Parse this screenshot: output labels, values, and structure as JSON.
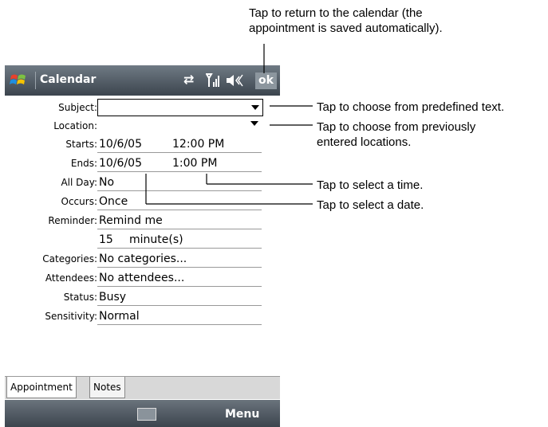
{
  "callouts": {
    "ok_note_line1": "Tap to return to the calendar (the",
    "ok_note_line2": "appointment is saved automatically).",
    "subject_note": "Tap to choose from predefined text.",
    "location_note_line1": "Tap to choose from previously",
    "location_note_line2": "entered locations.",
    "time_note": "Tap to select a time.",
    "date_note": "Tap to select a date."
  },
  "title_bar": {
    "title": "Calendar",
    "ok_label": "ok",
    "icons": [
      "windows-logo-icon",
      "connectivity-icon",
      "signal-icon",
      "volume-icon"
    ]
  },
  "form": {
    "subject": {
      "label": "Subject:",
      "value": ""
    },
    "location": {
      "label": "Location:",
      "value": ""
    },
    "starts": {
      "label": "Starts:",
      "date": "10/6/05",
      "time": "12:00 PM"
    },
    "ends": {
      "label": "Ends:",
      "date": "10/6/05",
      "time": "1:00 PM"
    },
    "all_day": {
      "label": "All Day:",
      "value": "No"
    },
    "occurs": {
      "label": "Occurs:",
      "value": "Once"
    },
    "reminder": {
      "label": "Reminder:",
      "value": "Remind me",
      "amount": "15",
      "unit": "minute(s)"
    },
    "categories": {
      "label": "Categories:",
      "value": "No categories..."
    },
    "attendees": {
      "label": "Attendees:",
      "value": "No attendees..."
    },
    "status": {
      "label": "Status:",
      "value": "Busy"
    },
    "sensitivity": {
      "label": "Sensitivity:",
      "value": "Normal"
    }
  },
  "tabs": [
    {
      "label": "Appointment",
      "selected": true
    },
    {
      "label": "Notes",
      "selected": false
    }
  ],
  "bottom_bar": {
    "menu_label": "Menu",
    "keyboard_icon": "keyboard-icon"
  }
}
